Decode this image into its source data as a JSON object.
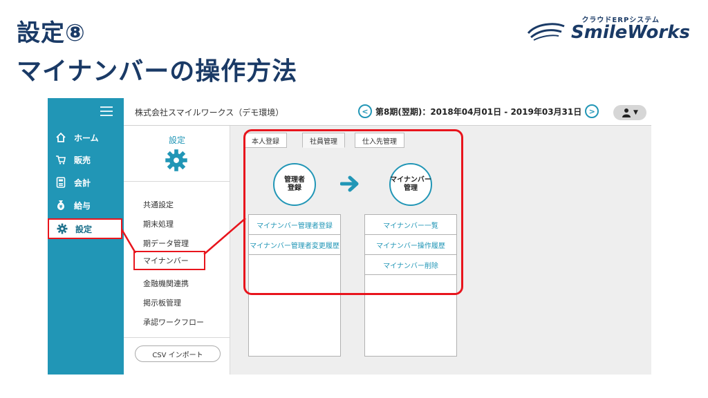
{
  "slide": {
    "title_line1": "設定⑧",
    "title_line2": "マイナンバーの操作方法",
    "logo_sub": "クラウドERPシステム",
    "logo_main": "SmileWorks"
  },
  "topbar": {
    "company": "株式会社スマイルワークス（デモ環境）",
    "period": "第8期(翌期)：2018年04月01日 - 2019年03月31日",
    "prev_icon": "chevron-left-icon",
    "next_icon": "chevron-right-icon",
    "user_icon": "user-icon"
  },
  "sidebar": {
    "items": [
      {
        "label": "ホーム",
        "icon": "home-icon"
      },
      {
        "label": "販売",
        "icon": "cart-icon"
      },
      {
        "label": "会計",
        "icon": "calculator-icon"
      },
      {
        "label": "給与",
        "icon": "money-bag-icon"
      },
      {
        "label": "設定",
        "icon": "gear-icon"
      }
    ],
    "active": "設定"
  },
  "submenu": {
    "title": "設定",
    "items": [
      "共通設定",
      "期末処理",
      "期データ管理",
      "マイナンバー",
      "金融機関連携",
      "掲示板管理",
      "承認ワークフロー"
    ],
    "active": "マイナンバー",
    "csv_button": "CSV インポート"
  },
  "main": {
    "tabs": [
      "本人登録",
      "社員管理",
      "仕入先管理"
    ],
    "active_tab": "社員管理",
    "left_circle": "管理者\n登録",
    "right_circle": "マイナンバー\n管理",
    "left_links": [
      "マイナンバー管理者登録",
      "マイナンバー管理者変更履歴"
    ],
    "right_links": [
      "マイナンバー一覧",
      "マイナンバー操作履歴",
      "マイナンバー削除"
    ]
  },
  "colors": {
    "brand": "#2196b6",
    "highlight": "#e8141c",
    "title": "#1a3a66"
  }
}
